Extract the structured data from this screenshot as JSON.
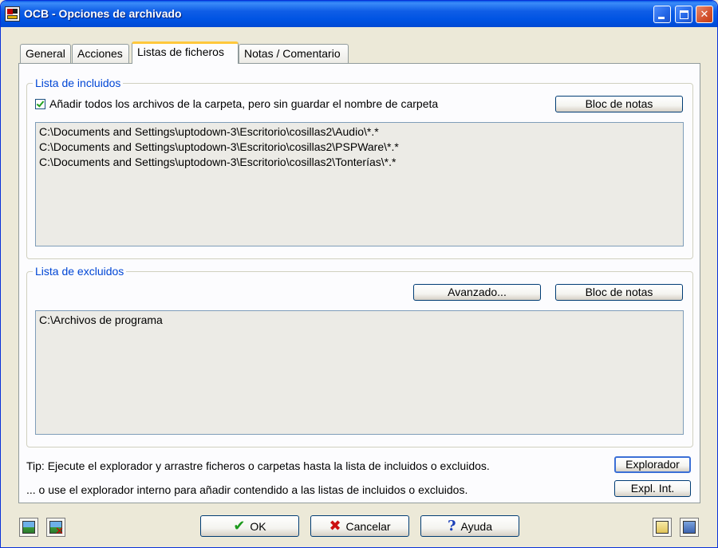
{
  "window": {
    "title": "OCB - Opciones de archivado",
    "controls": [
      "minimize-icon",
      "maximize-icon",
      "close-icon"
    ]
  },
  "tabs": [
    {
      "label": "General",
      "active": false
    },
    {
      "label": "Acciones",
      "active": false
    },
    {
      "label": "Listas de ficheros",
      "active": true
    },
    {
      "label": "Notas / Comentario",
      "active": false
    }
  ],
  "included": {
    "legend": "Lista de incluidos",
    "checkbox_label": "Añadir todos los archivos de la carpeta, pero sin guardar el nombre de carpeta",
    "checkbox_checked": true,
    "notepad_button": "Bloc de notas",
    "items": [
      "C:\\Documents and Settings\\uptodown-3\\Escritorio\\cosillas2\\Audio\\*.*",
      "C:\\Documents and Settings\\uptodown-3\\Escritorio\\cosillas2\\PSPWare\\*.*",
      "C:\\Documents and Settings\\uptodown-3\\Escritorio\\cosillas2\\Tonterías\\*.*"
    ]
  },
  "excluded": {
    "legend": "Lista de excluidos",
    "advanced_button": "Avanzado...",
    "notepad_button": "Bloc de notas",
    "items": [
      "C:\\Archivos de programa"
    ]
  },
  "tips": {
    "tip1": "Tip: Ejecute el explorador y arrastre ficheros o carpetas hasta la lista de incluidos o excluidos.",
    "tip2": "... o use el explorador interno para añadir contendido a las listas de incluidos o excluidos.",
    "explorer_button": "Explorador",
    "internal_explorer_button": "Expl. Int."
  },
  "footer": {
    "ok_label": "OK",
    "cancel_label": "Cancelar",
    "help_label": "Ayuda",
    "left_icons": [
      "image-icon",
      "delete-image-icon"
    ],
    "right_icons": [
      "folder-icon",
      "save-icon"
    ]
  }
}
